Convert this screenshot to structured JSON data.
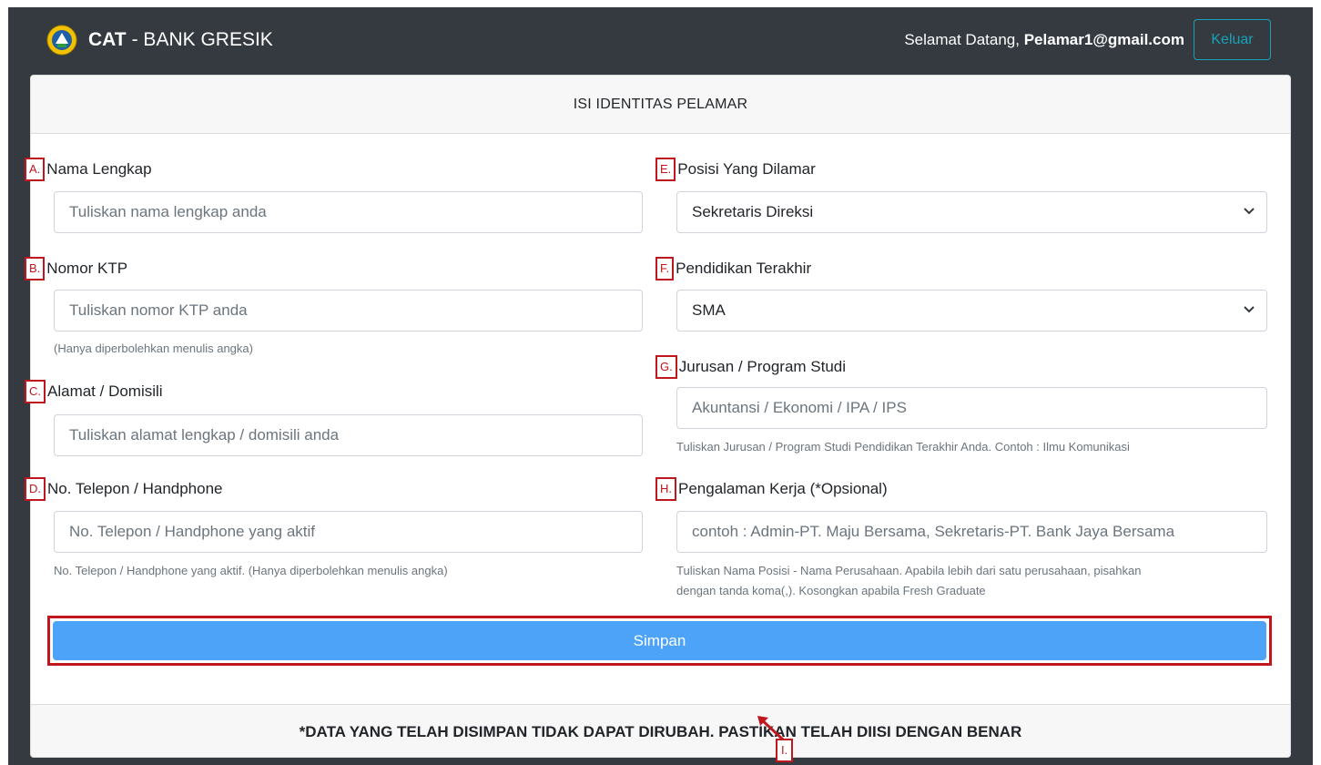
{
  "app": {
    "brand_bold": "CAT",
    "brand_rest": "- BANK GRESIK",
    "welcome_text": "Selamat Datang,",
    "user_email": "Pelamar1@gmail.com",
    "logout_label": "Keluar"
  },
  "card": {
    "title": "ISI IDENTITAS PELAMAR",
    "footer_note": "*DATA YANG TELAH DISIMPAN TIDAK DAPAT DIRUBAH. PASTIKAN TELAH DIISI DENGAN BENAR"
  },
  "form": {
    "name": {
      "marker": "A.",
      "label": "Nama Lengkap",
      "placeholder": "Tuliskan nama lengkap anda"
    },
    "ktp": {
      "marker": "B.",
      "label": "Nomor KTP",
      "placeholder": "Tuliskan nomor KTP anda",
      "help": "(Hanya diperbolehkan menulis angka)"
    },
    "address": {
      "marker": "C.",
      "label": "Alamat / Domisili",
      "placeholder": "Tuliskan alamat lengkap / domisili anda"
    },
    "phone": {
      "marker": "D.",
      "label": "No. Telepon / Handphone",
      "placeholder": "No. Telepon / Handphone yang aktif",
      "help": "No. Telepon / Handphone yang aktif. (Hanya diperbolehkan menulis angka)"
    },
    "position": {
      "marker": "E.",
      "label": "Posisi Yang Dilamar",
      "selected": "Sekretaris Direksi"
    },
    "education": {
      "marker": "F.",
      "label": "Pendidikan Terakhir",
      "selected": "SMA"
    },
    "major": {
      "marker": "G.",
      "label": "Jurusan / Program Studi",
      "placeholder": "Akuntansi / Ekonomi / IPA / IPS",
      "help": "Tuliskan Jurusan / Program Studi Pendidikan Terakhir Anda. Contoh : Ilmu Komunikasi"
    },
    "experience": {
      "marker": "H.",
      "label": "Pengalaman Kerja (*Opsional)",
      "placeholder": "contoh : Admin-PT. Maju Bersama, Sekretaris-PT. Bank Jaya Bersama",
      "help_line1": "Tuliskan Nama Posisi - Nama Perusahaan. Apabila lebih dari satu perusahaan, pisahkan",
      "help_line2": "dengan tanda koma(,). Kosongkan apabila Fresh Graduate"
    },
    "save_label": "Simpan",
    "save_marker": "I."
  },
  "colors": {
    "navbar": "#343a40",
    "primary_button": "#4da3f7",
    "annotation_red": "#c0161e",
    "logout_outline": "#17a2b8"
  },
  "icons": {
    "logo": "bank-gresik-emblem-icon",
    "select_arrow": "chevron-down-icon",
    "annotation": "arrow-icon"
  }
}
